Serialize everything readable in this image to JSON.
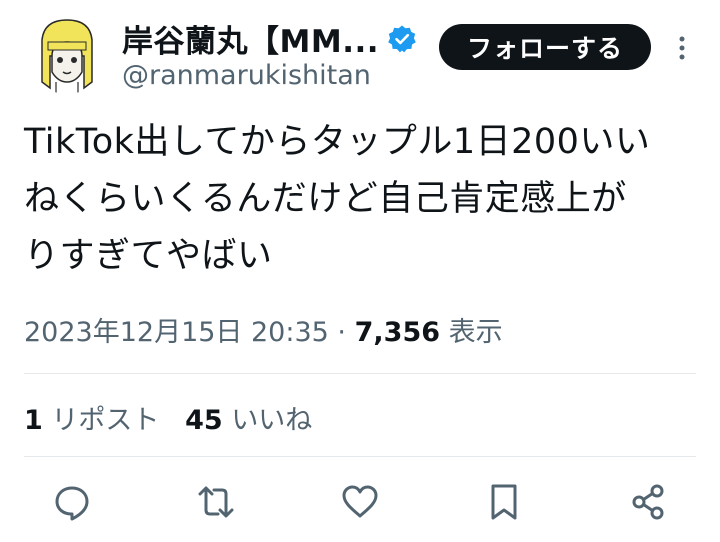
{
  "author": {
    "display_name": "岸谷蘭丸【MM...",
    "handle": "@ranmarukishitan",
    "verified": true,
    "avatar_icon": "avatar-illustration-icon"
  },
  "follow_button": {
    "label": "フォローする"
  },
  "tweet": {
    "text": "TikTok出してからタップル1日200いい\nねくらいくるんだけど自己肯定感上が\nりすぎてやばい",
    "timestamp": "2023年12月15日 20:35",
    "separator": "·",
    "view_count": "7,356",
    "view_label": "表示"
  },
  "stats": {
    "reposts_count": "1",
    "reposts_label": "リポスト",
    "likes_count": "45",
    "likes_label": "いいね"
  },
  "actions": [
    "reply-icon",
    "repost-icon",
    "like-icon",
    "bookmark-icon",
    "share-icon"
  ],
  "colors": {
    "text": "#0f1419",
    "secondary": "#536471",
    "follow_bg": "#0f1419",
    "verified": "#1d9bf0",
    "divider": "#e6e9eb"
  }
}
